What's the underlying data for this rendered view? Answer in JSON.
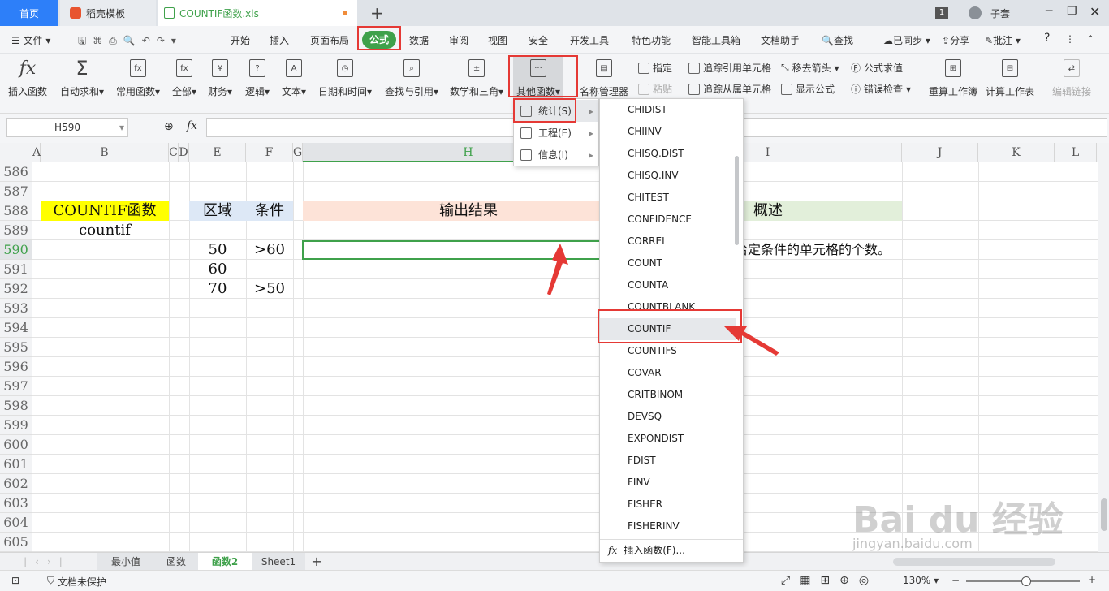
{
  "tabs": {
    "home": "首页",
    "daoke": "稻壳模板",
    "file": "COUNTIF函数.xls",
    "page_count": "1",
    "user": "子套"
  },
  "menu": {
    "file": "文件",
    "items": [
      "开始",
      "插入",
      "页面布局",
      "公式",
      "数据",
      "审阅",
      "视图",
      "安全",
      "开发工具",
      "特色功能",
      "智能工具箱",
      "文档助手"
    ],
    "search": "查找",
    "sync": "已同步",
    "share": "分享",
    "comment": "批注"
  },
  "ribbon": {
    "buttons": [
      "插入函数",
      "自动求和",
      "常用函数",
      "全部",
      "财务",
      "逻辑",
      "文本",
      "日期和时间",
      "查找与引用",
      "数学和三角",
      "其他函数",
      "名称管理器"
    ],
    "assign": "指定",
    "paste": "粘贴",
    "trace_prec": "追踪引用单元格",
    "trace_dep": "追踪从属单元格",
    "remove_arrows": "移去箭头",
    "show_formula": "显示公式",
    "eval": "公式求值",
    "err_check": "错误检查",
    "recalc_book": "重算工作簿",
    "calc_sheet": "计算工作表",
    "edit_links": "编辑链接"
  },
  "formula_bar": {
    "name_box": "H590",
    "fx": "fx"
  },
  "columns": [
    "A",
    "B",
    "C",
    "D",
    "E",
    "F",
    "G",
    "H",
    "I",
    "J",
    "K",
    "L"
  ],
  "rows": [
    "586",
    "587",
    "588",
    "589",
    "590",
    "591",
    "592",
    "593",
    "594",
    "595",
    "596",
    "597",
    "598",
    "599",
    "600",
    "601",
    "602",
    "603",
    "604",
    "605"
  ],
  "cells": {
    "title": "COUNTIF函数",
    "lower": "countif",
    "range_hdr": "区域",
    "cond_hdr": "条件",
    "output_hdr": "输出结果",
    "summary_hdr": "概述",
    "e590": "50",
    "e591": "60",
    "e592": "70",
    "f590": ">60",
    "f592": ">50",
    "summary_text": "给定条件的单元格的个数。"
  },
  "submenu": {
    "stats": "统计(S)",
    "eng": "工程(E)",
    "info": "信息(I)"
  },
  "functions": [
    "CHIDIST",
    "CHIINV",
    "CHISQ.DIST",
    "CHISQ.INV",
    "CHITEST",
    "CONFIDENCE",
    "CORREL",
    "COUNT",
    "COUNTA",
    "COUNTBLANK",
    "COUNTIF",
    "COUNTIFS",
    "COVAR",
    "CRITBINOM",
    "DEVSQ",
    "EXPONDIST",
    "FDIST",
    "FINV",
    "FISHER",
    "FISHERINV"
  ],
  "insert_fn": "插入函数(F)...",
  "sheets": [
    "最小值",
    "函数",
    "函数2",
    "Sheet1"
  ],
  "status": {
    "protect": "文档未保护",
    "zoom": "130%"
  },
  "watermark": {
    "brand": "Bai du 经验",
    "url": "jingyan.baidu.com"
  },
  "colors": {
    "accent": "#3fa14b",
    "red": "#e53935",
    "yellow": "#ffff00",
    "peach": "#fde3d8",
    "green_hdr": "#e2efda",
    "blue_hdr": "#dde8f6"
  }
}
